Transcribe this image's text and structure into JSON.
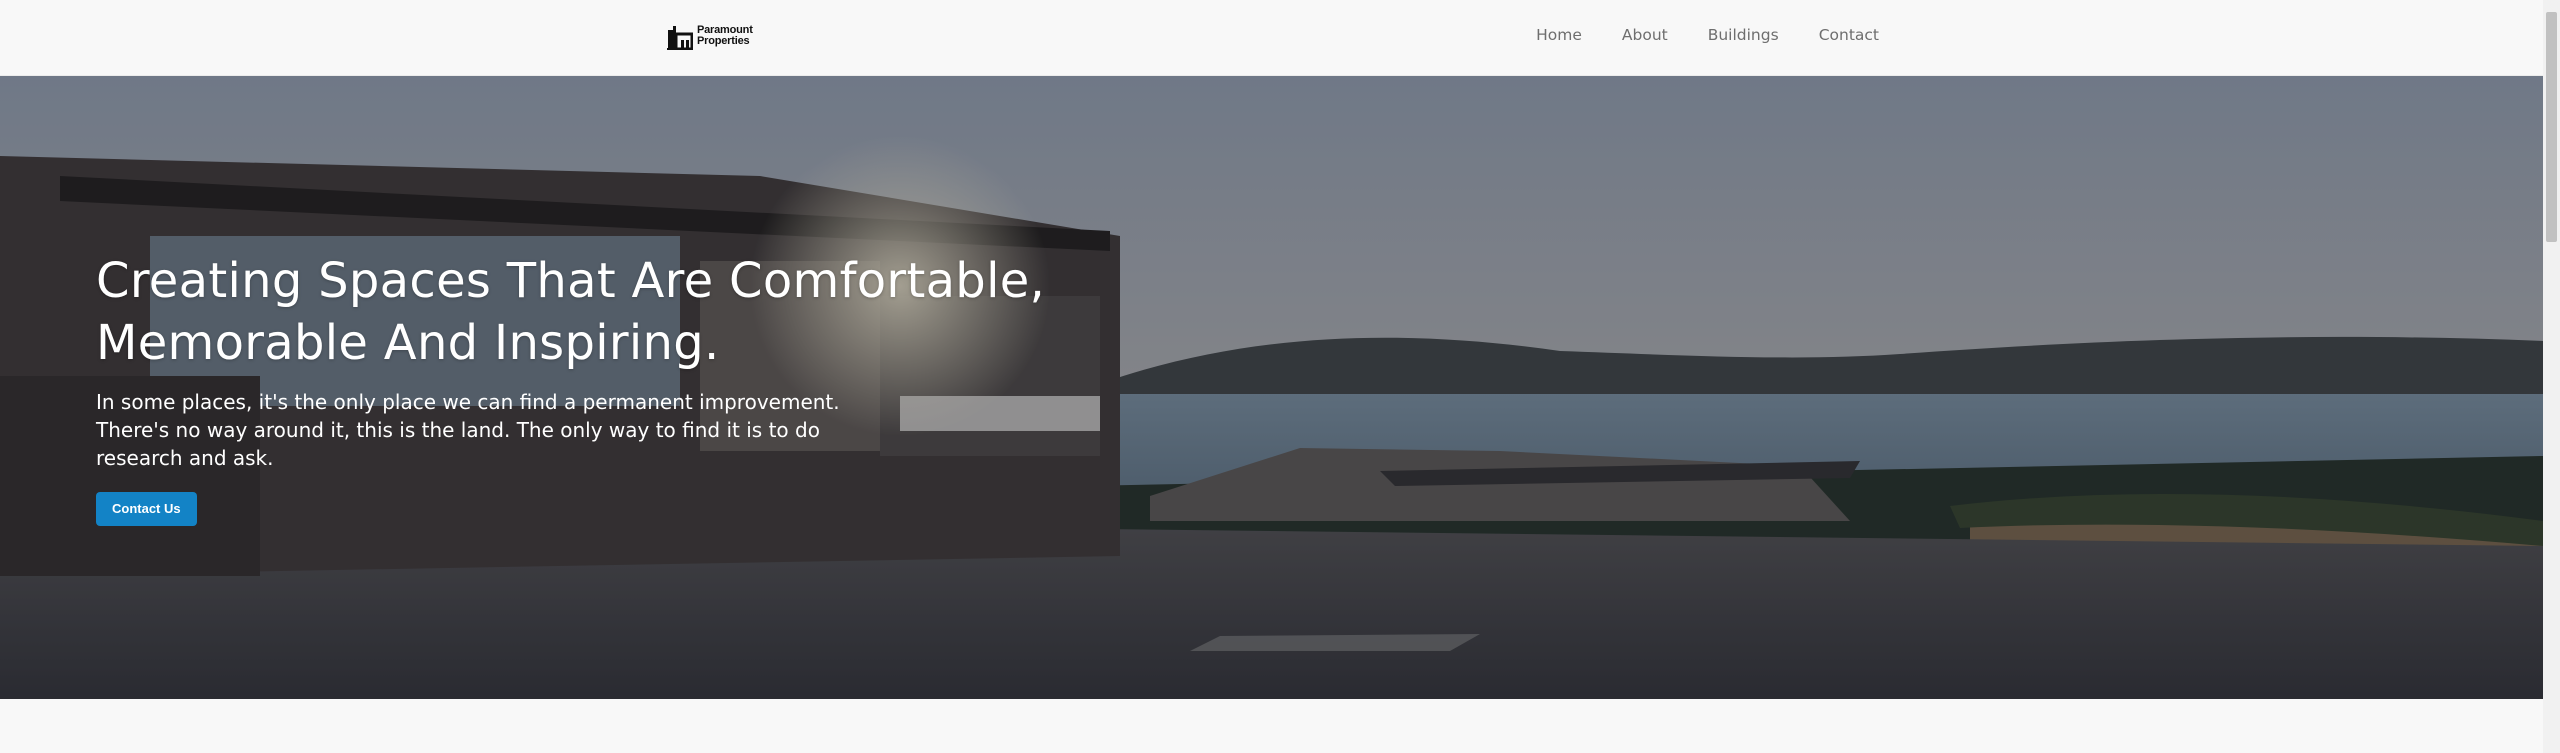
{
  "brand": {
    "line1": "Paramount",
    "line2": "Properties",
    "icon": "building-icon"
  },
  "nav": {
    "items": [
      "Home",
      "About",
      "Buildings",
      "Contact"
    ]
  },
  "hero": {
    "title_line1": "Creating Spaces That Are Comfortable,",
    "title_line2": "Memorable And Inspiring.",
    "text_line1": "In some places, it's the only place we can find a permanent improvement.",
    "text_line2": "There's no way around it, this is the land. The only way to find it is to do",
    "text_line3": "research and ask.",
    "cta_label": "Contact Us",
    "image": "seaside-villa-photo"
  },
  "colors": {
    "accent": "#1383c6",
    "nav_bg": "#f8f8f8",
    "nav_text": "#6e6e6e"
  }
}
